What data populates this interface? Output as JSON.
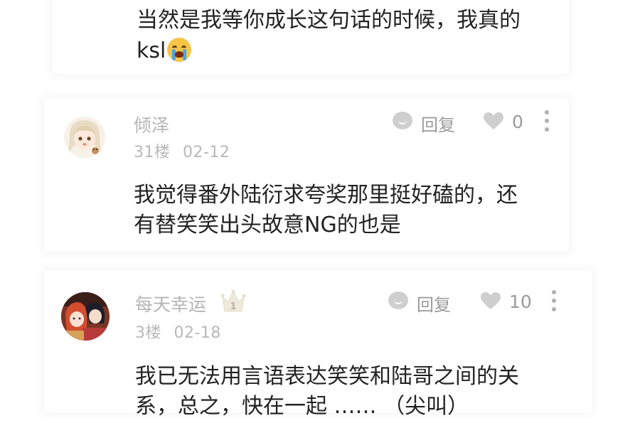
{
  "comments": [
    {
      "text_lines": [
        "当然是我等你成长这句话的时候，我真的",
        "ksl"
      ],
      "emoji": "loudly-crying-face-emoji"
    },
    {
      "username": "倾泽",
      "floor": "31楼",
      "date": "02-12",
      "reply_label": "回复",
      "like_count": "0",
      "text_lines": [
        "我觉得番外陆衍求夸奖那里挺好磕的，还",
        "有替笑笑出头故意NG的也是"
      ]
    },
    {
      "username": "每天幸运",
      "badge_number": "1",
      "floor": "3楼",
      "date": "02-18",
      "reply_label": "回复",
      "like_count": "10",
      "text_lines": [
        "我已无法用言语表达笑笑和陆哥之间的关",
        "系，总之，快在一起 …… （尖叫）"
      ]
    }
  ],
  "icons": {
    "reply": "comment-bubble-icon",
    "like": "heart-icon",
    "more": "more-vertical-icon",
    "badge": "crown-badge-icon"
  },
  "colors": {
    "text": "#222222",
    "meta": "#b8b8b8",
    "icon": "#cfcfcf"
  }
}
